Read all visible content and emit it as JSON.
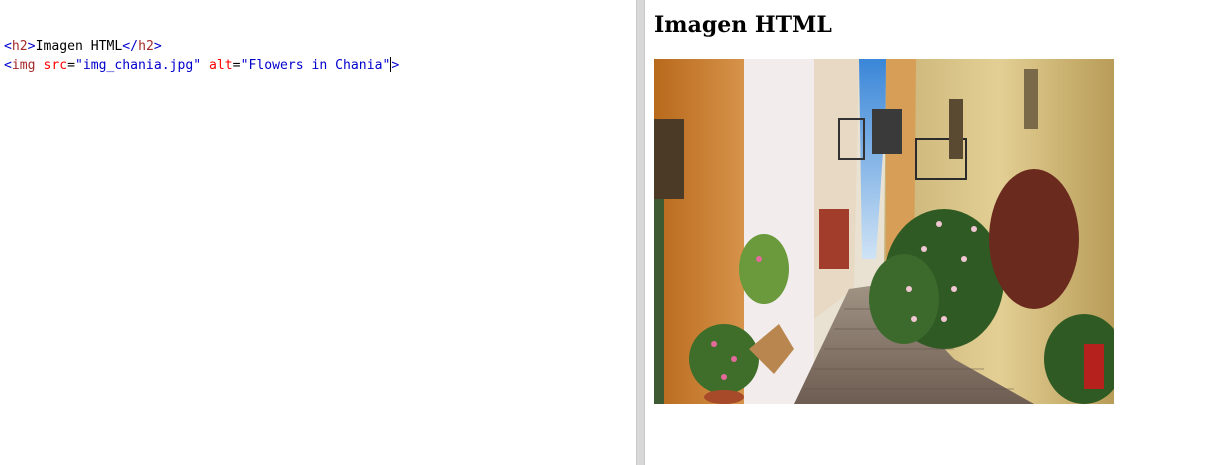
{
  "editor": {
    "lines": [
      [
        {
          "kind": "bracket",
          "text": "<"
        },
        {
          "kind": "tag",
          "text": "h2"
        },
        {
          "kind": "bracket",
          "text": ">"
        },
        {
          "kind": "text",
          "text": "Imagen HTML"
        },
        {
          "kind": "bracket",
          "text": "</"
        },
        {
          "kind": "tag",
          "text": "h2"
        },
        {
          "kind": "bracket",
          "text": ">"
        }
      ],
      [
        {
          "kind": "bracket",
          "text": "<"
        },
        {
          "kind": "tag",
          "text": "img"
        },
        {
          "kind": "text",
          "text": " "
        },
        {
          "kind": "attr",
          "text": "src"
        },
        {
          "kind": "text",
          "text": "="
        },
        {
          "kind": "value",
          "text": "\"img_chania.jpg\""
        },
        {
          "kind": "text",
          "text": " "
        },
        {
          "kind": "attr",
          "text": "alt"
        },
        {
          "kind": "text",
          "text": "="
        },
        {
          "kind": "value",
          "text": "\"Flowers in Chania\""
        },
        {
          "kind": "cursor",
          "text": ""
        },
        {
          "kind": "bracket",
          "text": ">"
        }
      ]
    ]
  },
  "result": {
    "heading": "Imagen HTML",
    "image_alt": "Flowers in Chania",
    "image_icon": "photo-icon"
  },
  "colors": {
    "bracket": "#0000cd",
    "tag": "#a52a2a",
    "attr": "#ff0000",
    "value": "#0000cd"
  }
}
